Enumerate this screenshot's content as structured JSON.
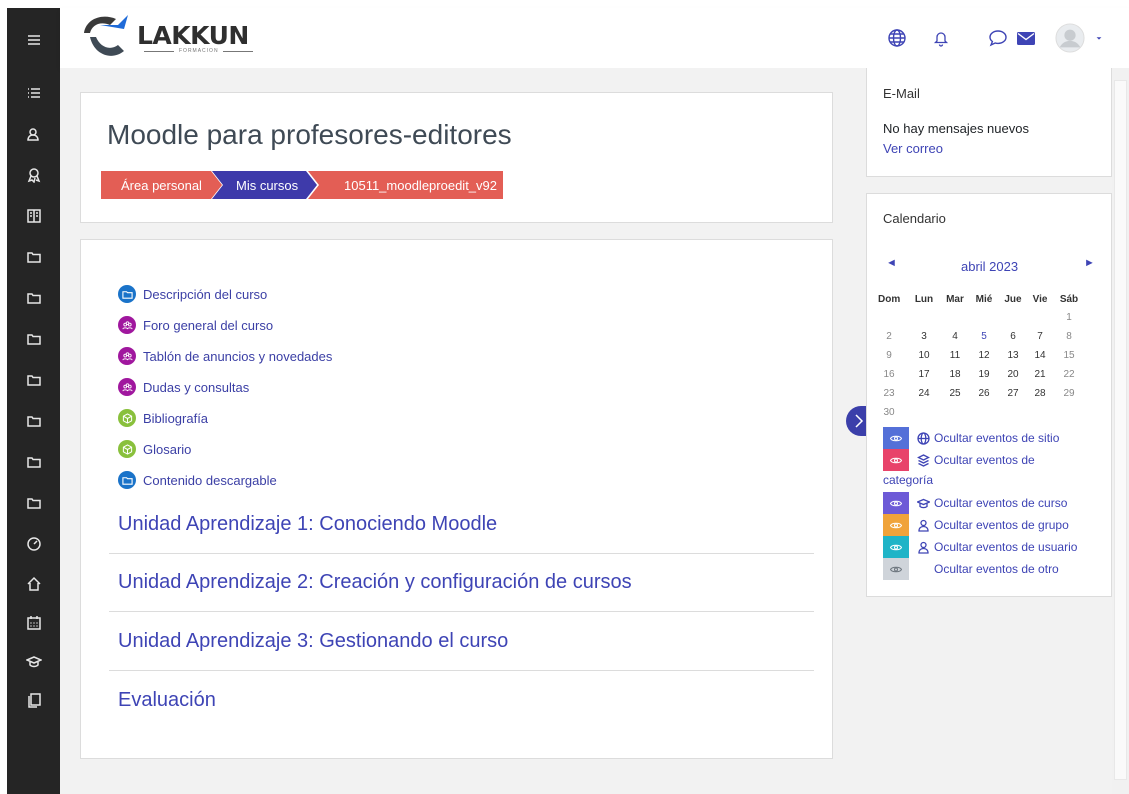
{
  "brand": {
    "name": "LAKKUN",
    "tagline": "FORMACION"
  },
  "page_title": "Moodle para profesores-editores",
  "breadcrumb": [
    {
      "label": "Área personal",
      "color": "#e35e55"
    },
    {
      "label": "Mis cursos",
      "color": "#3e3aaa"
    },
    {
      "label": "10511_moodleproedit_v92",
      "color": "#e35e55"
    }
  ],
  "activities": [
    {
      "label": "Descripción del curso",
      "icon": "folder-icon",
      "color": "#1a73c9"
    },
    {
      "label": "Foro general del curso",
      "icon": "forum-icon",
      "color": "#a0179e"
    },
    {
      "label": "Tablón de anuncios y novedades",
      "icon": "forum-icon",
      "color": "#a0179e"
    },
    {
      "label": "Dudas y consultas",
      "icon": "forum-icon",
      "color": "#a0179e"
    },
    {
      "label": "Bibliografía",
      "icon": "glossary-icon",
      "color": "#89c03c"
    },
    {
      "label": "Glosario",
      "icon": "glossary-icon",
      "color": "#89c03c"
    },
    {
      "label": "Contenido descargable",
      "icon": "folder-icon",
      "color": "#1a73c9"
    }
  ],
  "sections": [
    "Unidad Aprendizaje 1: Conociendo Moodle",
    "Unidad Aprendizaje 2: Creación y configuración de cursos",
    "Unidad Aprendizaje 3: Gestionando el curso",
    "Evaluación"
  ],
  "email_block": {
    "title": "E-Mail",
    "status": "No hay mensajes nuevos",
    "link": "Ver correo"
  },
  "calendar": {
    "title": "Calendario",
    "month": "abril 2023",
    "prev": "◄",
    "next": "►",
    "weekdays": [
      "Dom",
      "Lun",
      "Mar",
      "Mié",
      "Jue",
      "Vie",
      "Sáb"
    ],
    "weeks": [
      [
        "",
        "",
        "",
        "",
        "",
        "",
        "1"
      ],
      [
        "2",
        "3",
        "4",
        "5",
        "6",
        "7",
        "8"
      ],
      [
        "9",
        "10",
        "11",
        "12",
        "13",
        "14",
        "15"
      ],
      [
        "16",
        "17",
        "18",
        "19",
        "20",
        "21",
        "22"
      ],
      [
        "23",
        "24",
        "25",
        "26",
        "27",
        "28",
        "29"
      ],
      [
        "30",
        "",
        "",
        "",
        "",
        "",
        ""
      ]
    ],
    "linked_day": "5",
    "events": [
      {
        "label": "Ocultar eventos de sitio",
        "swatch": "#5470d8",
        "icon": "globe-icon"
      },
      {
        "label": "Ocultar eventos de",
        "label_cont": "categoría",
        "swatch": "#e8436a",
        "icon": "cubes-icon"
      },
      {
        "label": "Ocultar eventos de curso",
        "swatch": "#6d5ad7",
        "icon": "graduation-cap-icon"
      },
      {
        "label": "Ocultar eventos de grupo",
        "swatch": "#f0a33a",
        "icon": "group-icon"
      },
      {
        "label": "Ocultar eventos de usuario",
        "swatch": "#1fb4c7",
        "icon": "user-icon"
      },
      {
        "label": "Ocultar eventos de otro",
        "swatch": "#cfd4da",
        "icon": ""
      }
    ]
  },
  "colors": {
    "sidebar": "#252525",
    "link": "#3e44b5",
    "accent": "#3b3faa"
  }
}
